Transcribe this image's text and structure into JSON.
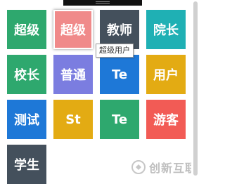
{
  "colors": {
    "green": "#2ea86e",
    "salmon": "#f08a8a",
    "slate": "#44505c",
    "teal": "#1fb0b4",
    "periwinkle": "#7b7de0",
    "blue": "#1e78d7",
    "mustard": "#e3ab13",
    "coral": "#f25b55"
  },
  "tiles": [
    {
      "label": "超级",
      "color": "#2ea86e"
    },
    {
      "label": "超级",
      "color": "#f08a8a"
    },
    {
      "label": "教师",
      "color": "#44505c"
    },
    {
      "label": "院长",
      "color": "#1fb0b4"
    },
    {
      "label": "校长",
      "color": "#2ea86e"
    },
    {
      "label": "普通",
      "color": "#7b7de0"
    },
    {
      "label": "Te",
      "color": "#1e78d7"
    },
    {
      "label": "用户",
      "color": "#e3ab13"
    },
    {
      "label": "测试",
      "color": "#1e78d7"
    },
    {
      "label": "St",
      "color": "#e3ab13"
    },
    {
      "label": "Te",
      "color": "#2ea86e"
    },
    {
      "label": "游客",
      "color": "#f25b55"
    },
    {
      "label": "学生",
      "color": "#44505c"
    }
  ],
  "tooltip": {
    "text": "超级用户"
  },
  "watermark": {
    "text": "创新互联",
    "icon": "brand-logo-icon"
  }
}
